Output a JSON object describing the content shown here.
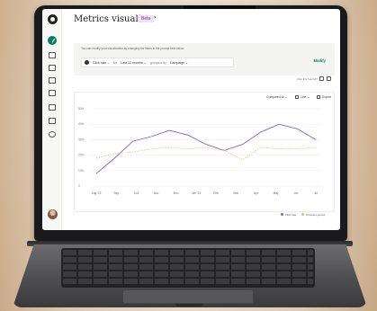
{
  "app": {
    "title": "Metrics visualizer",
    "badge": "Beta",
    "brand_color": "#0f7c62",
    "accent_purple": "#8b5ec9",
    "accent_yellow": "#d9c26a"
  },
  "sidebar": {
    "icons": [
      "logo-icon",
      "create-icon",
      "campaigns-icon",
      "audience-icon",
      "automations-icon",
      "website-icon",
      "content-icon",
      "integrations-icon",
      "search-icon",
      "avatar"
    ]
  },
  "filters": {
    "description": "You can modify your visualization by changing the filters in the prompt field below.",
    "metric": "Click rate",
    "for_label": "for",
    "period": "Last 12 months",
    "grouped_label": "grouped by",
    "group": "Campaign",
    "modify_label": "Modify"
  },
  "feedback": {
    "question": "Was this helpful?"
  },
  "chart_controls": {
    "compare": "Compared to",
    "type": "Line",
    "export": "Export"
  },
  "chart_data": {
    "type": "line",
    "x": [
      "Aug '22",
      "Sep",
      "Oct",
      "Nov",
      "Dec",
      "Jan '23",
      "Feb",
      "Mar",
      "Apr",
      "May",
      "Jun",
      "Jul"
    ],
    "ylim": [
      0,
      50
    ],
    "yticks": [
      "50%",
      "40%",
      "30%",
      "20%",
      "10%",
      "0"
    ],
    "series": [
      {
        "name": "Click rate",
        "color": "#8b5ec9",
        "style": "solid",
        "values": [
          8,
          18,
          29,
          32,
          36,
          33,
          27,
          23,
          27,
          35,
          40,
          37,
          30
        ]
      },
      {
        "name": "Previous period",
        "color": "#d9c26a",
        "style": "dashed",
        "values": [
          18,
          21,
          22,
          24,
          25,
          24,
          25,
          23,
          17,
          25,
          24,
          24,
          25
        ]
      }
    ]
  }
}
